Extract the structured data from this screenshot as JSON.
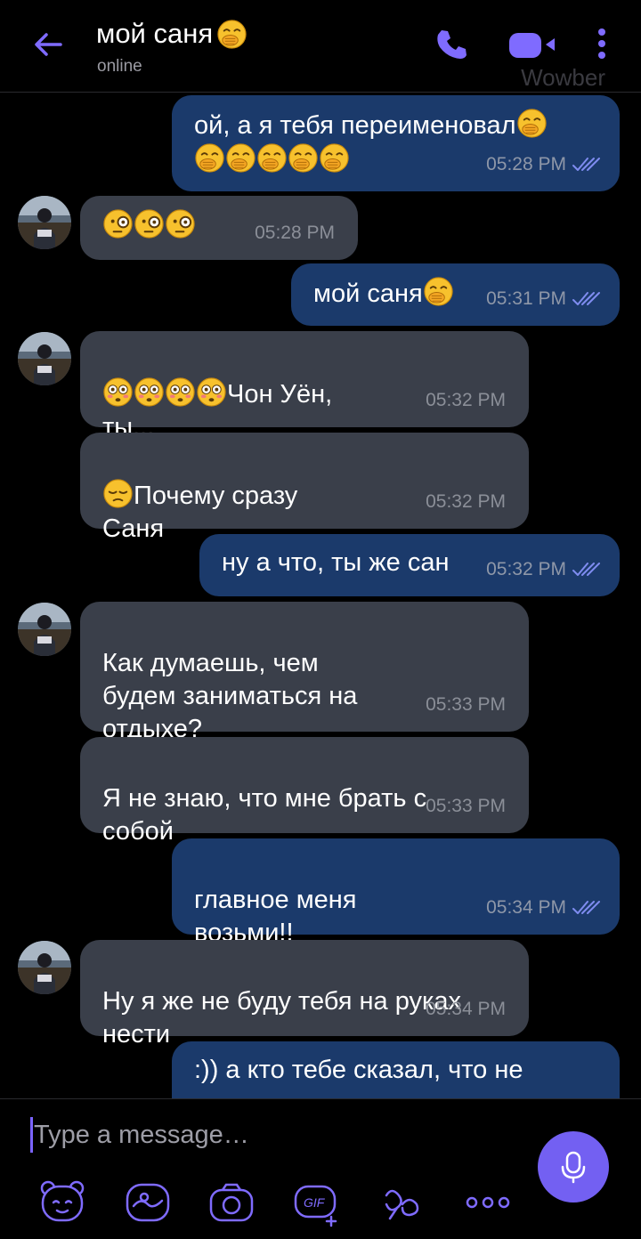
{
  "header": {
    "contact_name": "мой саня",
    "status": "online",
    "watermark": "Wowber",
    "icons": [
      "back-arrow-icon",
      "phone-icon",
      "video-icon",
      "more-vert-icon"
    ]
  },
  "colors": {
    "accent": "#7360f2",
    "outgoing_bubble": "#1b3a6b",
    "incoming_bubble": "#3a3f4a",
    "background": "#000000"
  },
  "messages": [
    {
      "direction": "out",
      "text": "ой, а я тебя переименовал",
      "time": "05:28 PM",
      "read": true
    },
    {
      "direction": "in",
      "text": "",
      "time": "05:28 PM"
    },
    {
      "direction": "out",
      "text": "мой саня",
      "time": "05:31 PM",
      "read": true
    },
    {
      "direction": "in",
      "text": "Чон Уён,\nты...",
      "time": "05:32 PM"
    },
    {
      "direction": "in",
      "text": "Почему сразу\nСаня",
      "time": "05:32 PM"
    },
    {
      "direction": "out",
      "text": "ну а что, ты же сан",
      "time": "05:32 PM",
      "read": true
    },
    {
      "direction": "in",
      "text": "Как думаешь, чем\nбудем заниматься на\nотдыхе?",
      "time": "05:33 PM"
    },
    {
      "direction": "in",
      "text": "Я не знаю, что мне брать с\nсобой",
      "time": "05:33 PM"
    },
    {
      "direction": "out",
      "text": "главное меня\nвозьми!!",
      "time": "05:34 PM",
      "read": true
    },
    {
      "direction": "in",
      "text": "Ну я же не буду тебя на руках\nнести",
      "time": "05:34 PM"
    },
    {
      "direction": "out",
      "text": ":)) а кто тебе сказал, что не",
      "time": "",
      "read": false
    }
  ],
  "composer": {
    "placeholder": "Type a message…",
    "tools": [
      "sticker-bear-icon",
      "doodle-icon",
      "camera-icon",
      "gif-icon",
      "more-apps-icon",
      "more-dots-icon"
    ]
  }
}
